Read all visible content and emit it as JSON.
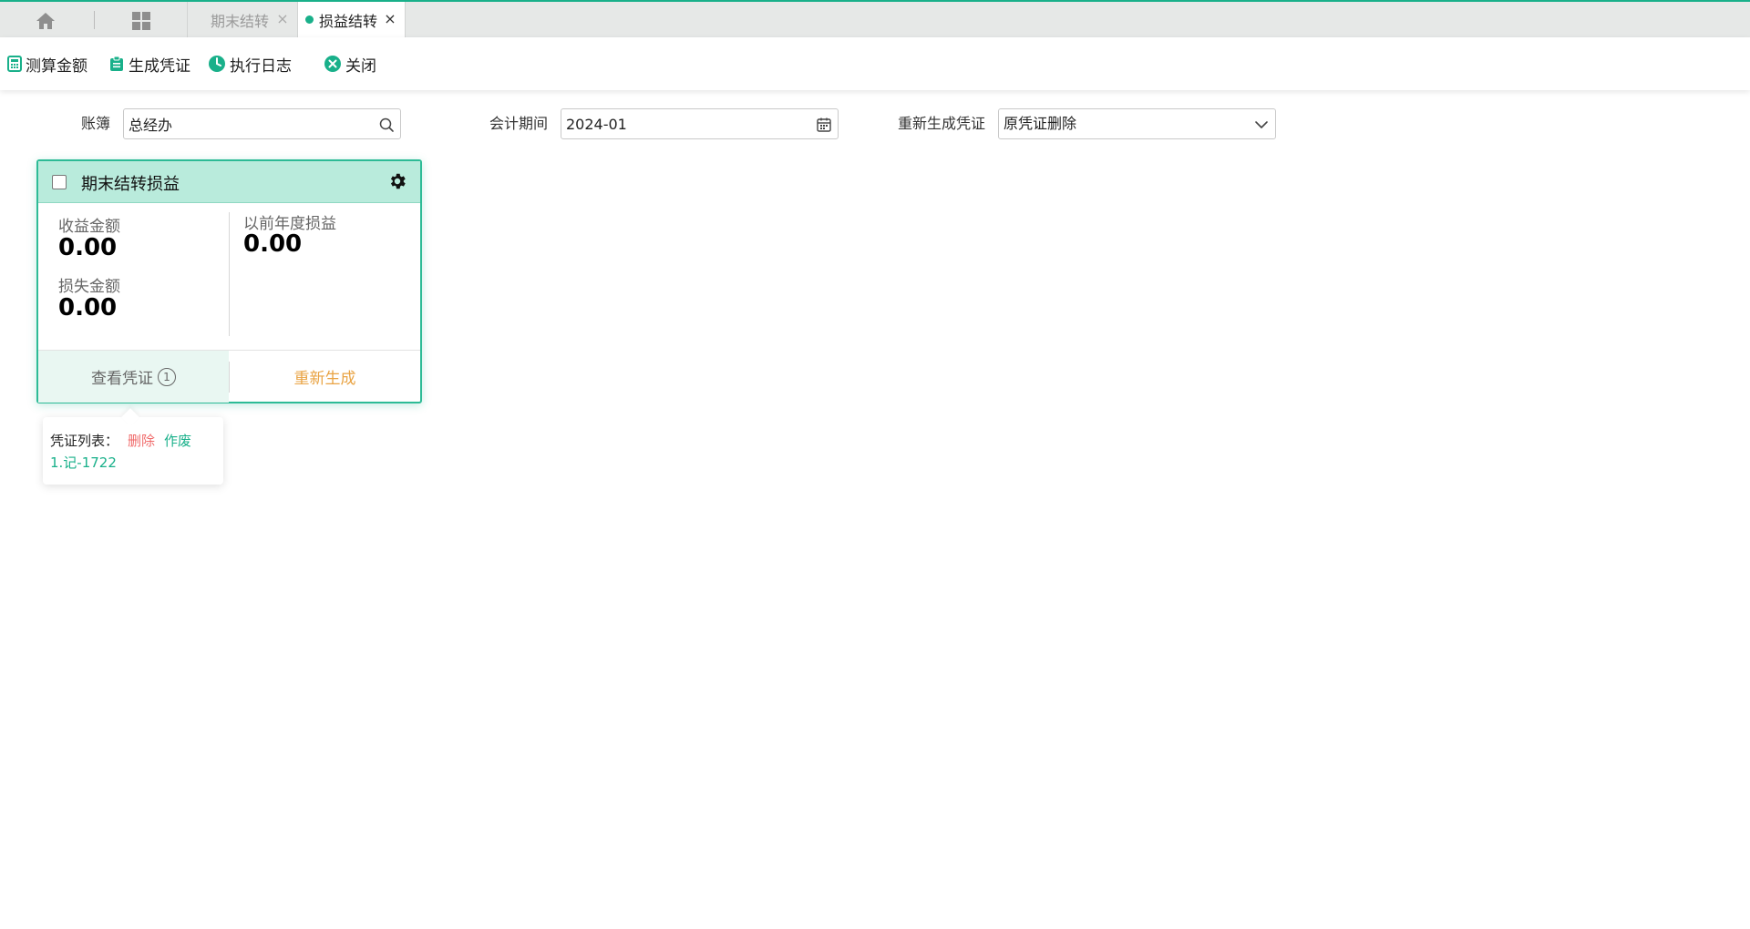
{
  "tabs": [
    {
      "label": "期末结转",
      "close": "×"
    },
    {
      "label": "损益结转",
      "close": "×"
    }
  ],
  "toolbar": {
    "calc": "测算金额",
    "generate": "生成凭证",
    "log": "执行日志",
    "close": "关闭"
  },
  "filters": {
    "ledger_label": "账簿",
    "ledger_value": "总经办",
    "period_label": "会计期间",
    "period_value": "2024-01",
    "regen_label": "重新生成凭证",
    "regen_value": "原凭证删除"
  },
  "card": {
    "title": "期末结转损益",
    "income_label": "收益金额",
    "income_value": "0.00",
    "loss_label": "损失金额",
    "loss_value": "0.00",
    "prior_label": "以前年度损益",
    "prior_value": "0.00",
    "view_voucher": "查看凭证",
    "voucher_count": "1",
    "regenerate": "重新生成"
  },
  "popover": {
    "label": "凭证列表：",
    "delete": "删除",
    "void": "作废",
    "items": [
      "1.记-1722"
    ]
  },
  "colors": {
    "accent": "#19b08a",
    "card_header": "#b9ebdc",
    "regenerate": "#e9a343",
    "delete": "#f06a6a"
  }
}
